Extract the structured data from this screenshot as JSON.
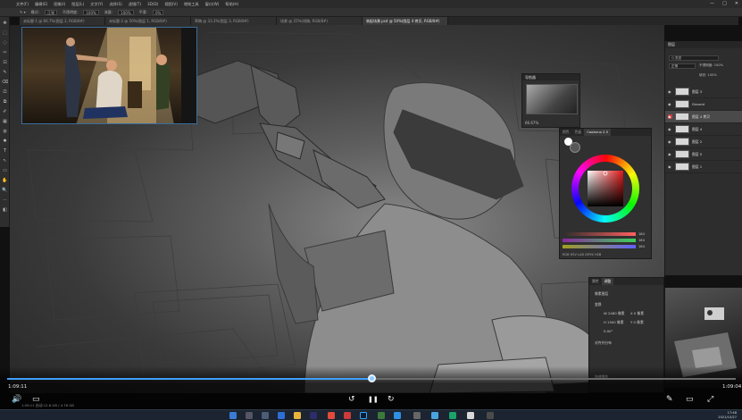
{
  "app": {
    "logo": "Ps",
    "menu": [
      "文件(F)",
      "编辑(E)",
      "图像(I)",
      "图层(L)",
      "文字(Y)",
      "选择(S)",
      "滤镜(T)",
      "3D(D)",
      "视图(V)",
      "增效工具",
      "窗口(W)",
      "帮助(H)"
    ],
    "window_controls": [
      "—",
      "□",
      "✕"
    ]
  },
  "options_bar": {
    "mode_label": "模式:",
    "mode_value": "正常",
    "opacity_label": "不透明度:",
    "opacity_value": "100%",
    "flow_label": "流量:",
    "flow_value": "100%",
    "smooth_label": "平滑:",
    "smooth_value": "0%"
  },
  "doc_tabs": [
    {
      "label": "未标题-1 @ 66.7%(图层 2, RGB/8#)",
      "active": false
    },
    {
      "label": "未标题-2 @ 50%(图层 1, RGB/8#)",
      "active": false
    },
    {
      "label": "草稿 @ 33.3%(图层 3, RGB/8#)",
      "active": false
    },
    {
      "label": "场景 @ 25%(线稿, RGB/8#)",
      "active": false
    },
    {
      "label": "装配场景.psd @ 50%(图层 4 拷贝, RGB/8#)",
      "active": true
    }
  ],
  "navigator": {
    "title": "导航器",
    "zoom": "66.67%"
  },
  "color_panel": {
    "tabs": [
      "颜色",
      "色板",
      "Coolorus 2.5"
    ],
    "active_tab": "Coolorus 2.5",
    "foreground": "#585858",
    "background": "#ffffff",
    "sliders": [
      {
        "label": "R",
        "value": "184",
        "gradient": "linear-gradient(90deg,#2e2e2e,#ff6060)"
      },
      {
        "label": "G",
        "value": "184",
        "gradient": "linear-gradient(90deg,#8a2aa0,#3ccf5a)"
      },
      {
        "label": "B",
        "value": "184",
        "gradient": "linear-gradient(90deg,#a0a020,#6060ff)"
      }
    ],
    "modes": "RGB  HSV  LAB  CMYK  HSB"
  },
  "layers_panel": {
    "title": "图层",
    "search_placeholder": "Q 类型",
    "blend": "正常",
    "opacity_label": "不透明度: 100%",
    "fill_label": "填充: 100%",
    "layers": [
      {
        "name": "图层 3",
        "visible": true,
        "selected": false
      },
      {
        "name": "Ground",
        "visible": true,
        "selected": false
      },
      {
        "name": "图层 4 拷贝",
        "visible": true,
        "selected": true
      },
      {
        "name": "图层 4",
        "visible": true,
        "selected": false
      },
      {
        "name": "图层 2",
        "visible": true,
        "selected": false
      },
      {
        "name": "图层 5",
        "visible": true,
        "selected": false
      },
      {
        "name": "图层 1",
        "visible": true,
        "selected": false
      }
    ]
  },
  "properties_panel": {
    "tabs": [
      "属性",
      "调整"
    ],
    "active_tab": "调整",
    "section": "像素图层",
    "transform": "变换",
    "w_label": "W 2480 像素",
    "h_label": "H 1500 像素",
    "x_label": "X 0 像素",
    "y_label": "Y 0 像素",
    "angle_label": "0.00°",
    "align_label": "对齐并分布",
    "quick_label": "快速操作"
  },
  "player": {
    "current_time": "1:09:11",
    "duration": "1:09:04",
    "progress": 0.5,
    "controls": {
      "volume": "🔊",
      "subtitles": "▭",
      "rewind": "↺",
      "pause": "❚❚",
      "forward": "↻",
      "pen": "✎",
      "pip": "▭",
      "fullscreen": "⤢"
    }
  },
  "os": {
    "info": "1:09:11   启动:12.8 GB / 4.78 GB",
    "clock_time": "17:48",
    "clock_date": "2021/10/27"
  },
  "colors": {
    "accent": "#3ea0ff",
    "ps_blue": "#31a8ff",
    "panel": "#2f2f2f"
  }
}
